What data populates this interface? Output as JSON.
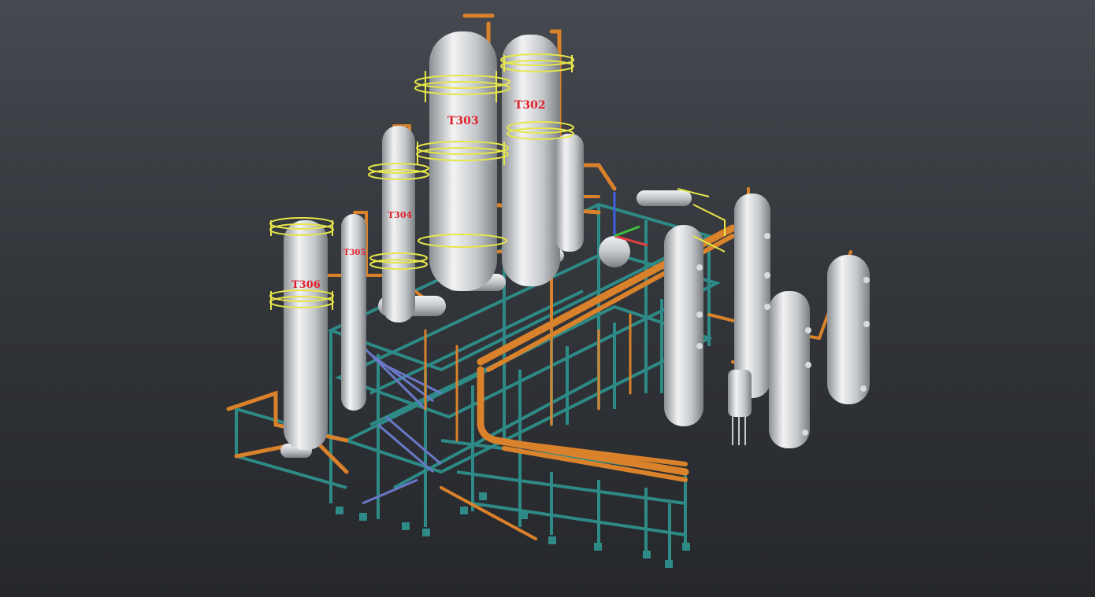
{
  "viewport": {
    "background_top": "#464a50",
    "background_bottom": "#25272b"
  },
  "colors": {
    "vessel": "#c8cbce",
    "pipe": "#d9822b",
    "steel": "#2e8a86",
    "platform": "#e6e64a",
    "stair": "#6a78c8",
    "tag_text": "#e0202a"
  },
  "tags": {
    "t302": "T302",
    "t303": "T303",
    "t304": "T304",
    "t305": "T305",
    "t306": "T306"
  },
  "axis_triad": {
    "x_color": "#e04040",
    "y_color": "#40c040",
    "z_color": "#4060e0"
  }
}
